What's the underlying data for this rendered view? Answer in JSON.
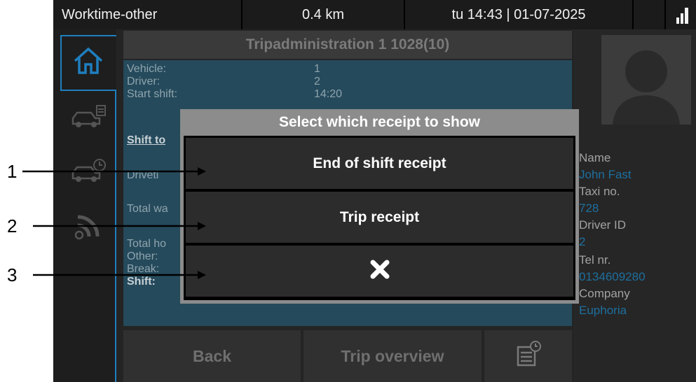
{
  "status_bar": {
    "mode": "Worktime-other",
    "distance": "0.4 km",
    "datetime": "tu 14:43 | 01-07-2025"
  },
  "main": {
    "title": "Tripadministration 1 1028(10)",
    "rows": [
      {
        "label": "Vehicle:",
        "value": "1"
      },
      {
        "label": "Driver:",
        "value": "2"
      },
      {
        "label": "Start shift:",
        "value": "14:20"
      }
    ],
    "partial_labels": {
      "shift_totals": "Shift to",
      "drivetime": "Driveti",
      "total_wait": "Total wa",
      "total_hours": "Total ho",
      "other": "Other:",
      "break": "Break:",
      "shift": "Shift:"
    }
  },
  "bottom": {
    "back": "Back",
    "trip_overview": "Trip overview"
  },
  "profile": {
    "name_label": "Name",
    "name_value": "John Fast",
    "taxi_label": "Taxi no.",
    "taxi_value": "728",
    "driver_label": "Driver ID",
    "driver_value": "2",
    "tel_label": "Tel nr.",
    "tel_value": "0134609280",
    "company_label": "Company",
    "company_value": "Euphoria"
  },
  "dialog": {
    "title": "Select which receipt to show",
    "options": [
      {
        "label": "End of shift receipt"
      },
      {
        "label": "Trip receipt"
      },
      {
        "label": "✖"
      }
    ]
  },
  "annotations": [
    "1",
    "2",
    "3"
  ],
  "colors": {
    "accent": "#1f7fbf",
    "panel": "#254a5c",
    "profile_value": "#1e6f9e"
  },
  "icons": [
    "home-icon",
    "taxi-icon",
    "taxi-clock-icon",
    "signal-icon",
    "receipt-clock-icon",
    "close-icon",
    "signal-bars-icon"
  ]
}
